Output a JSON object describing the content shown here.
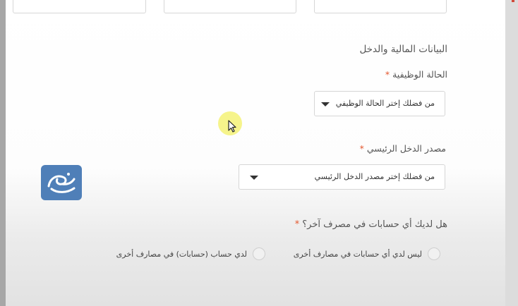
{
  "section": {
    "title": "البيانات المالية والدخل"
  },
  "employment_status": {
    "label": "الحالة الوظيفية",
    "required_mark": "*",
    "placeholder": "من فضلك إختر الحالة الوظيفي"
  },
  "income_source": {
    "label": "مصدر الدخل الرئيسي",
    "required_mark": "*",
    "placeholder": "من فضلك إختر مصدر الدخل الرئيسي"
  },
  "other_accounts": {
    "question": "هل لديك أي حسابات في مصرف آخر؟",
    "required_mark": "*",
    "options": [
      {
        "label": "ليس لدي أي حسابات في مصارف أخرى",
        "selected": false
      },
      {
        "label": "لدي حساب (حسابات) في مصارف أخرى",
        "selected": false
      }
    ]
  },
  "colors": {
    "required": "#e4572e",
    "cursor_highlight": "#f4f277",
    "watermark_bg": "#4f7fb8"
  },
  "icons": {
    "caret": "caret-down-icon",
    "cursor": "mouse-pointer-icon",
    "watermark": "site-logo-watermark"
  }
}
